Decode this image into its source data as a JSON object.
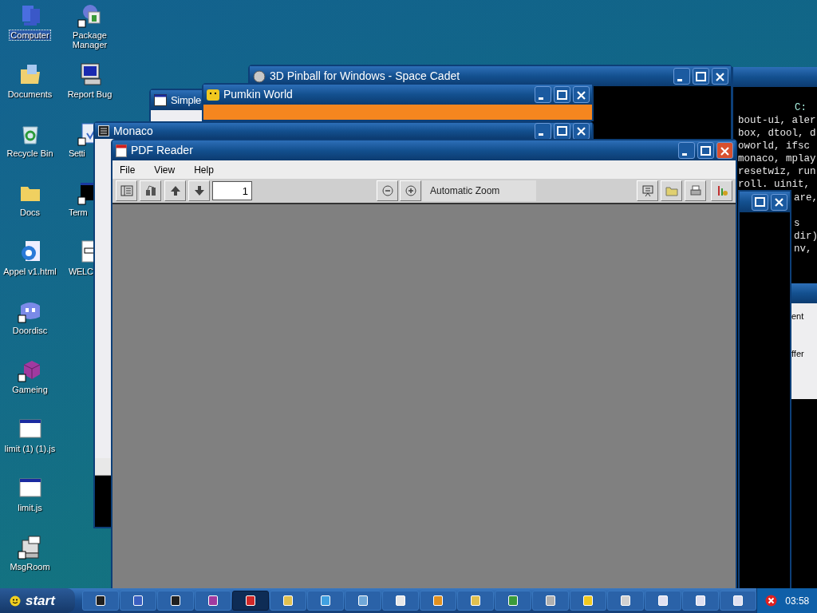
{
  "desktop": {
    "columns": [
      [
        {
          "label": "Computer",
          "kind": "computer",
          "shortcut": false,
          "selected": true
        },
        {
          "label": "Documents",
          "kind": "documents",
          "shortcut": false,
          "selected": false
        },
        {
          "label": "Recycle Bin",
          "kind": "recycle",
          "shortcut": false,
          "selected": false
        },
        {
          "label": "Docs",
          "kind": "folder",
          "shortcut": false,
          "selected": false
        },
        {
          "label": "Appel v1.html",
          "kind": "browser",
          "shortcut": false,
          "selected": false
        },
        {
          "label": "Doordisc",
          "kind": "chat",
          "shortcut": true,
          "selected": false
        },
        {
          "label": "Gameing",
          "kind": "cube",
          "shortcut": true,
          "selected": false
        },
        {
          "label": "limit (1) (1).js",
          "kind": "window",
          "shortcut": false,
          "selected": false
        },
        {
          "label": "limit.js",
          "kind": "window",
          "shortcut": false,
          "selected": false
        },
        {
          "label": "MsgRoom",
          "kind": "message",
          "shortcut": true,
          "selected": false
        }
      ],
      [
        {
          "label": "Package Manager",
          "kind": "package",
          "shortcut": true,
          "selected": false
        },
        {
          "label": "Report Bug",
          "kind": "monitor",
          "shortcut": false,
          "selected": false
        },
        {
          "label": "Setti",
          "kind": "settings",
          "shortcut": true,
          "selected": false
        },
        {
          "label": "Term",
          "kind": "terminal",
          "shortcut": true,
          "selected": false
        },
        {
          "label": "WELC",
          "kind": "document",
          "shortcut": false,
          "selected": false
        }
      ]
    ]
  },
  "terminal_window": {
    "prompt": "C:",
    "lines": [
      "bout-ui, aler",
      "box, dtool, d",
      "oworld, ifsc",
      "monaco, mplay",
      "resetwiz, run",
      "roll. uinit,"
    ],
    "lower_lines": [
      "are,",
      "s",
      "dir)",
      "nv,"
    ]
  },
  "side_window": {
    "lines": [
      "ent",
      "ffer"
    ]
  },
  "pinball_window": {
    "title": "3D Pinball for Windows - Space Cadet"
  },
  "simple_window": {
    "title": "Simple"
  },
  "pumkin_window": {
    "title": "Pumkin World"
  },
  "monaco_window": {
    "title": "Monaco"
  },
  "pdf_reader": {
    "title": "PDF Reader",
    "active": true,
    "menu": [
      "File",
      "View",
      "Help"
    ],
    "page": "1",
    "zoom": "Automatic Zoom"
  },
  "taskbar": {
    "start": "start",
    "clock": "03:58",
    "items": [
      {
        "color": "#202020",
        "selected": false
      },
      {
        "color": "#3a5fc0",
        "selected": false
      },
      {
        "color": "#202020",
        "selected": false
      },
      {
        "color": "#a03aa0",
        "selected": false
      },
      {
        "color": "#d02828",
        "selected": true
      },
      {
        "color": "#e0c050",
        "selected": false
      },
      {
        "color": "#40a0e0",
        "selected": false
      },
      {
        "color": "#70a8d8",
        "selected": false
      },
      {
        "color": "#e8e8e8",
        "selected": false
      },
      {
        "color": "#e09020",
        "selected": false
      },
      {
        "color": "#e0c050",
        "selected": false
      },
      {
        "color": "#3a9a3a",
        "selected": false
      },
      {
        "color": "#b0b0b0",
        "selected": false
      },
      {
        "color": "#f0c820",
        "selected": false
      },
      {
        "color": "#d0d0d0",
        "selected": false
      },
      {
        "color": "#e0e0f0",
        "selected": false
      },
      {
        "color": "#e0e0f0",
        "selected": false
      },
      {
        "color": "#e0e0f0",
        "selected": false
      }
    ]
  }
}
